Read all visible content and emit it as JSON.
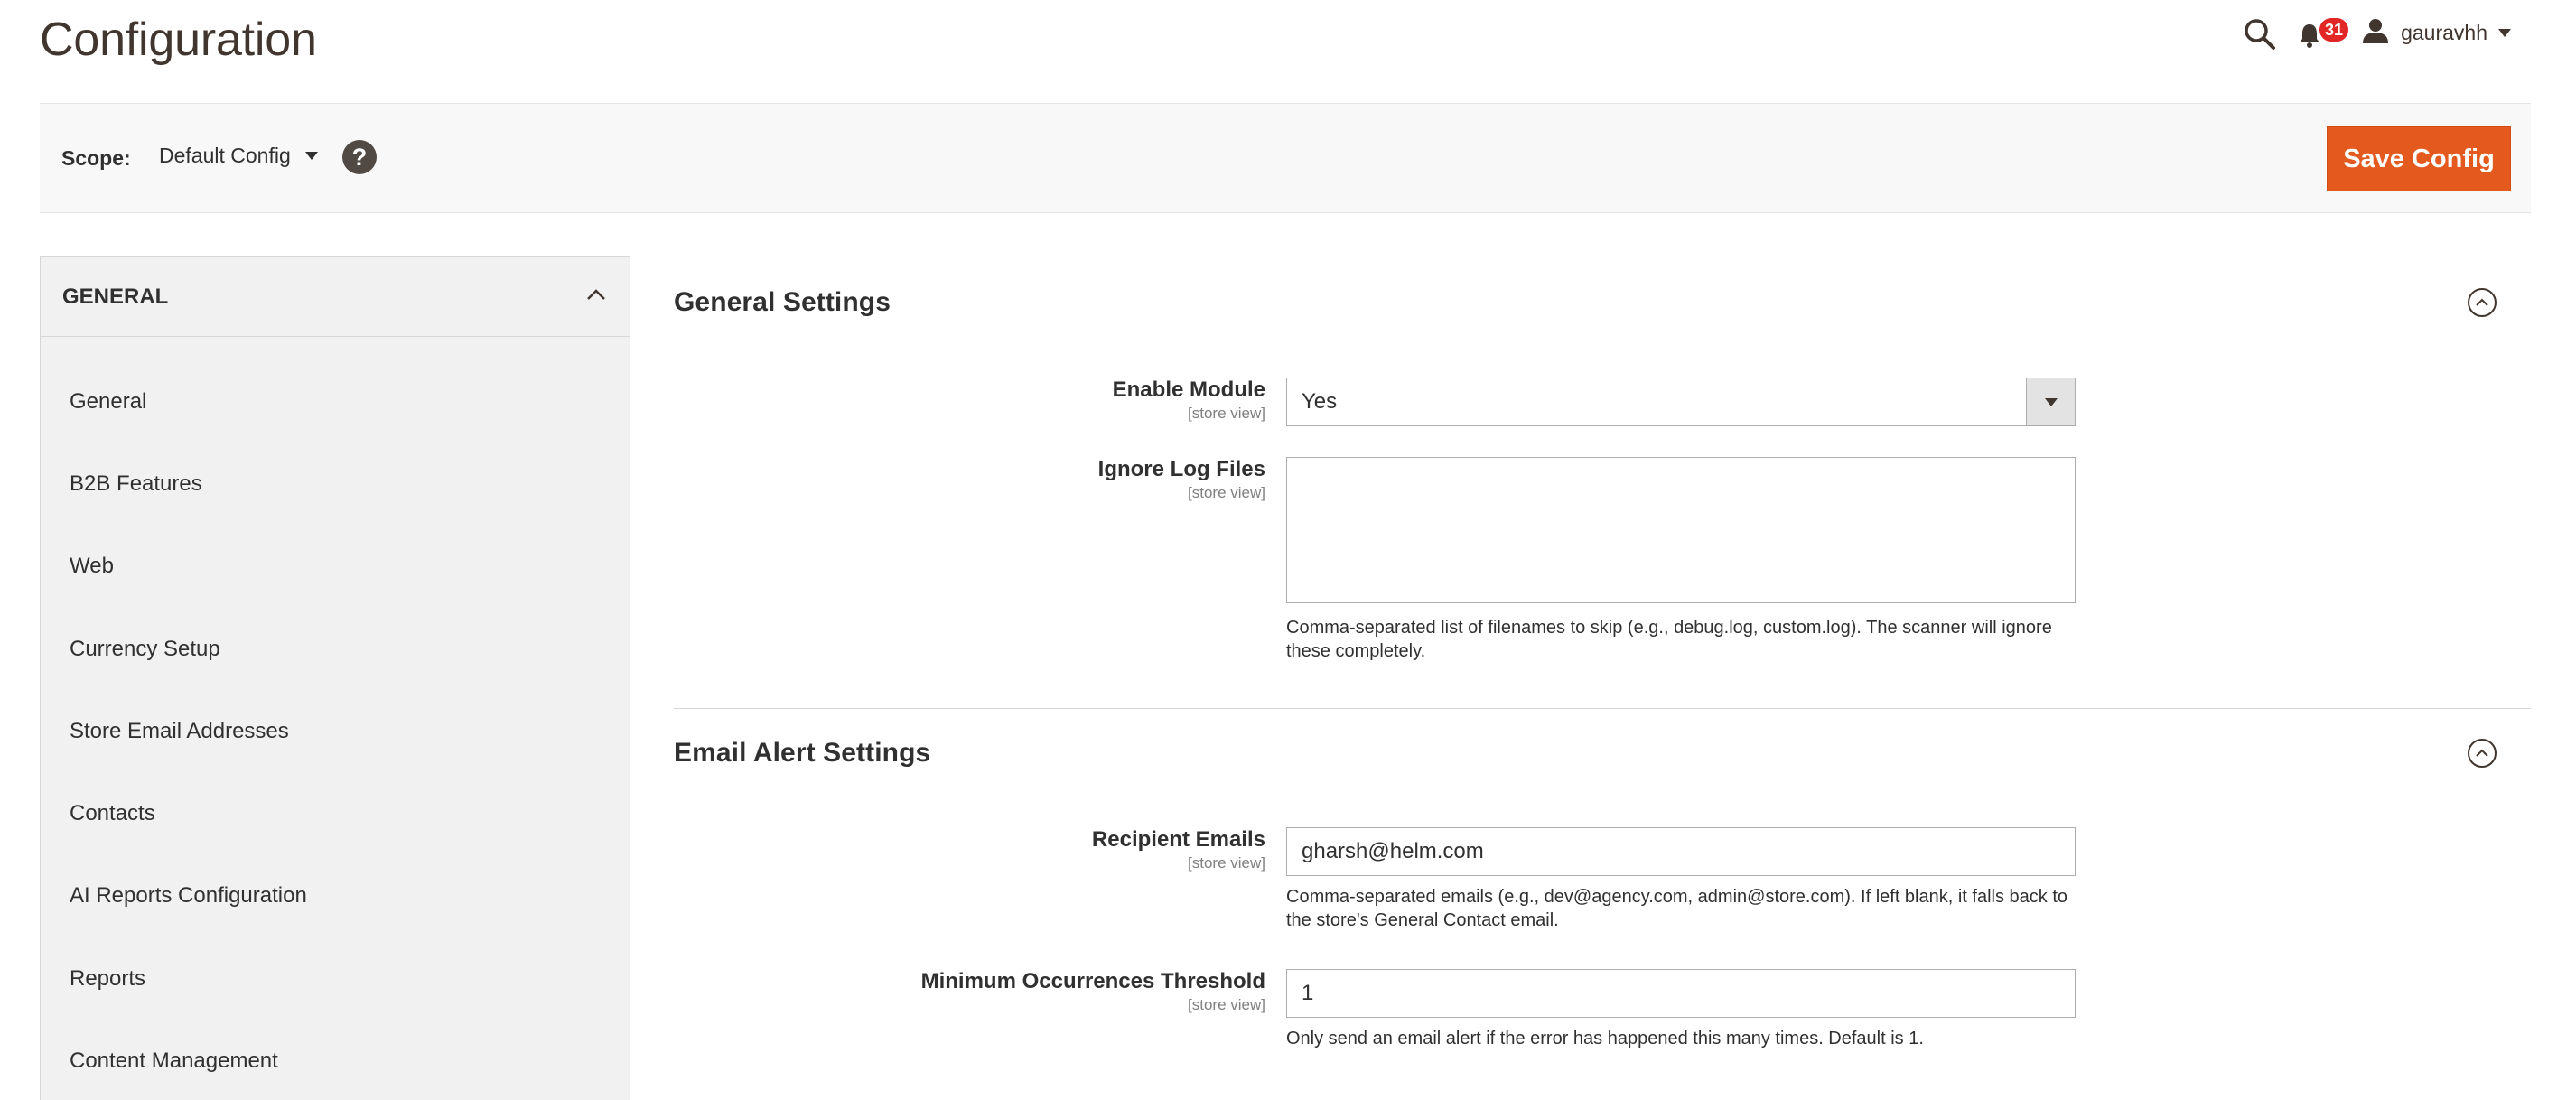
{
  "header": {
    "title": "Configuration",
    "notifications_count": "31",
    "username": "gauravhh",
    "icons": {
      "search": "search-icon",
      "notifications": "bell-icon",
      "user": "user-icon"
    }
  },
  "scope": {
    "label": "Scope:",
    "value": "Default Config",
    "help": "?",
    "save_label": "Save Config"
  },
  "sidebar": {
    "title": "GENERAL",
    "items": [
      {
        "label": "General"
      },
      {
        "label": "B2B Features"
      },
      {
        "label": "Web"
      },
      {
        "label": "Currency Setup"
      },
      {
        "label": "Store Email Addresses"
      },
      {
        "label": "Contacts"
      },
      {
        "label": "AI Reports Configuration"
      },
      {
        "label": "Reports"
      },
      {
        "label": "Content Management"
      }
    ]
  },
  "general_settings": {
    "title": "General Settings",
    "enable_module": {
      "label": "Enable Module",
      "scope": "[store view]",
      "value": "Yes"
    },
    "ignore_log_files": {
      "label": "Ignore Log Files",
      "scope": "[store view]",
      "value": "",
      "note": "Comma-separated list of filenames to skip (e.g., debug.log, custom.log). The scanner will ignore these completely."
    }
  },
  "email_alert_settings": {
    "title": "Email Alert Settings",
    "recipient_emails": {
      "label": "Recipient Emails",
      "scope": "[store view]",
      "value": "gharsh@helm.com",
      "note": "Comma-separated emails (e.g., dev@agency.com, admin@store.com). If left blank, it falls back to the store's General Contact email."
    },
    "min_occurrences": {
      "label": "Minimum Occurrences Threshold",
      "scope": "[store view]",
      "value": "1",
      "note": "Only send an email alert if the error has happened this many times. Default is 1."
    }
  },
  "colors": {
    "accent": "#e3591e",
    "badge": "#e22626",
    "sidebar_bg": "#f1f1f1",
    "scope_bar_bg": "#f8f8f8"
  }
}
